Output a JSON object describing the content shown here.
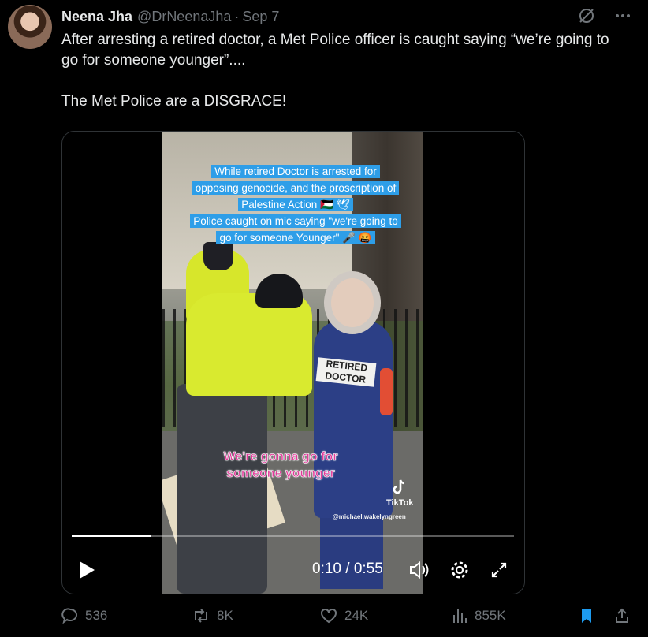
{
  "author": {
    "name": "Neena Jha",
    "handle": "@DrNeenaJha",
    "separator": "·",
    "date": "Sep 7"
  },
  "tweet": {
    "text_line1": "After arresting a retired doctor, a Met Police officer is caught saying “we’re going to go for someone younger”....",
    "text_line2": "The Met Police are a DISGRACE!"
  },
  "video": {
    "caption": {
      "line1": "While retired Doctor is arrested for",
      "line2": "opposing genocide, and the proscription of",
      "line3": "Palestine Action 🇵🇸 🕊",
      "line4": "Police caught on mic saying \"we're going to",
      "line5": "go for someone Younger\" 🎤 🤬"
    },
    "subtitle_line1": "We're gonna go for",
    "subtitle_line2": "someone younger",
    "sash_text": "RETIRED DOCTOR",
    "watermark_brand": "TikTok",
    "watermark_handle": "@michael.wakelyngreen",
    "progress_fraction": 0.18,
    "current_time": "0:10",
    "time_separator": "/",
    "duration": "0:55"
  },
  "actions": {
    "replies": "536",
    "reposts": "8K",
    "likes": "24K",
    "views": "855K"
  },
  "colors": {
    "background": "#000000",
    "text": "#e7e9ea",
    "muted": "#71767b",
    "bookmark_active": "#1d9bf0",
    "caption_bg": "#2e9ee8",
    "subtitle_pink": "#e23b9a"
  }
}
